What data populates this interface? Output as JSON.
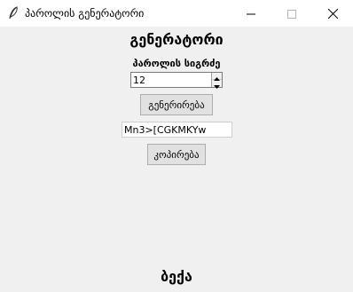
{
  "window": {
    "title": "პაროლის გენერატორი",
    "app_icon": "feather-icon",
    "controls": [
      "minimize-icon",
      "maximize-icon",
      "close-icon"
    ]
  },
  "main": {
    "heading": "გენერატორი",
    "length_label": "პაროლის სიგრძე",
    "length_value": "12",
    "generate_label": "გენერირება",
    "password_value": "Mn3>[CGKMKYw",
    "copy_label": "კოპირება",
    "footer": "ბექა"
  }
}
